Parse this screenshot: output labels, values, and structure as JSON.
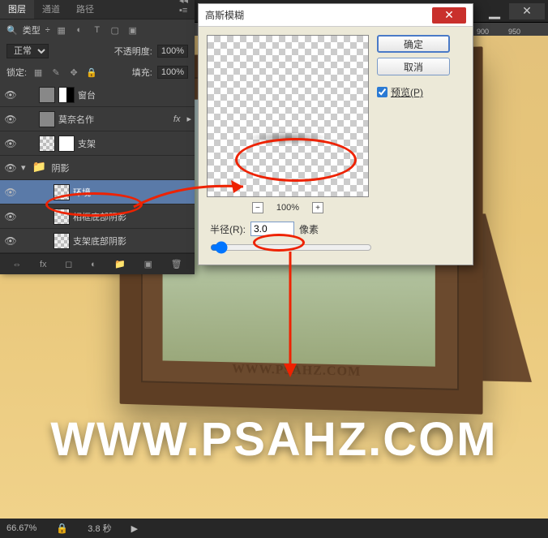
{
  "top_bar": {
    "minimize": "▁",
    "close": "✕"
  },
  "ruler": {
    "ticks": [
      "900",
      "950"
    ]
  },
  "layers_panel": {
    "tabs": [
      "图层",
      "通道",
      "路径"
    ],
    "type_label": "类型",
    "blend_mode": "正常",
    "opacity_label": "不透明度:",
    "opacity_value": "100%",
    "lock_label": "锁定:",
    "fill_label": "填充:",
    "fill_value": "100%",
    "layers": [
      {
        "name": "窗台",
        "fx": false
      },
      {
        "name": "莫奈名作",
        "fx": true
      },
      {
        "name": "支架",
        "fx": false
      },
      {
        "name": "阴影",
        "folder": true
      },
      {
        "name": "环境",
        "indent": 2,
        "selected": true
      },
      {
        "name": "相框底部阴影",
        "indent": 2
      },
      {
        "name": "支架底部阴影",
        "indent": 2
      }
    ]
  },
  "dialog": {
    "title": "高斯模糊",
    "zoom": "100%",
    "ok": "确定",
    "cancel": "取消",
    "preview": "预览(P)",
    "radius_label": "半径(R):",
    "radius_value": "3.0",
    "radius_unit": "像素"
  },
  "frame": {
    "url": "WWW.PSAHZ.COM"
  },
  "watermark": "WWW.PSAHZ.COM",
  "status": {
    "zoom": "66.67%",
    "time": "3.8 秒"
  }
}
